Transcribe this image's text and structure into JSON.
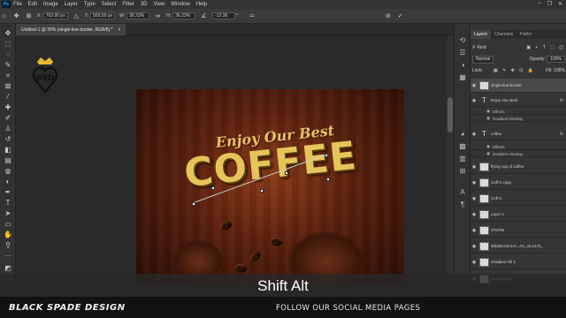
{
  "menubar": {
    "app_icon": "Ps",
    "items": [
      "File",
      "Edit",
      "Image",
      "Layer",
      "Type",
      "Select",
      "Filter",
      "3D",
      "View",
      "Window",
      "Help"
    ],
    "window_controls": [
      "–",
      "❐",
      "✕"
    ]
  },
  "options": {
    "x_label": "X:",
    "x_value": "763.00 px",
    "y_label": "Y:",
    "y_value": "569.50 px",
    "w_label": "W:",
    "w_value": "36.23%",
    "h_label": "H:",
    "h_value": "36.23%",
    "angle_value": "-12.38",
    "angle_unit": "°"
  },
  "document": {
    "tab_title": "Untitled-1 @ 39% (single-line-border, RGB/8) *"
  },
  "artwork": {
    "headline": "Enjoy Our Best",
    "title": "COFFEE",
    "logo_text": "BSD"
  },
  "layers": {
    "tabs": [
      "Layers",
      "Channels",
      "Paths"
    ],
    "filter_label": "Kind",
    "blend_mode": "Normal",
    "opacity_label": "Opacity:",
    "opacity_value": "100%",
    "lock_label": "Lock:",
    "fill_label": "Fill:",
    "fill_value": "100%",
    "rows": [
      {
        "name": "single-line-border",
        "type": "raster",
        "selected": true
      },
      {
        "name": "Enjoy Our Best",
        "type": "text",
        "fx": "fx"
      },
      {
        "name": "Effects",
        "type": "sub"
      },
      {
        "name": "Gradient Overlay",
        "type": "sub"
      },
      {
        "name": "coffee",
        "type": "text",
        "fx": "fx"
      },
      {
        "name": "Effects",
        "type": "sub"
      },
      {
        "name": "Gradient Overlay",
        "type": "sub"
      },
      {
        "name": "flying cup of coffee",
        "type": "raster"
      },
      {
        "name": "Coff K copy",
        "type": "raster"
      },
      {
        "name": "Coff K",
        "type": "raster"
      },
      {
        "name": "Layer 1",
        "type": "raster"
      },
      {
        "name": "370799",
        "type": "raster"
      },
      {
        "name": "5bbd5c19c1Al...AC_SL1376_",
        "type": "raster"
      },
      {
        "name": "Gradient Fill 1",
        "type": "raster"
      },
      {
        "name": "Background",
        "type": "raster"
      }
    ]
  },
  "overlay": {
    "shortcut": "Shift Alt"
  },
  "footer": {
    "brand": "BLACK SPADE DESIGN",
    "follow": "FOLLOW OUR SOCIAL MEDIA PAGES"
  },
  "colors": {
    "app_bg": "#282828",
    "accent": "#31a8ff",
    "gold": "#e6c45a"
  }
}
